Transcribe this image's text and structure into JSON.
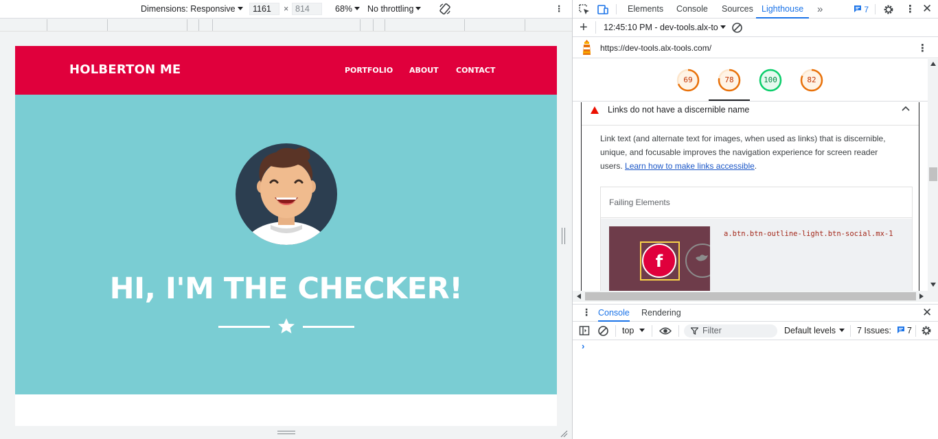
{
  "device_toolbar": {
    "dimensions_label": "Dimensions: Responsive",
    "width": "1161",
    "height": "814",
    "zoom": "68%",
    "throttling": "No throttling",
    "rotate_icon": "rotate-icon"
  },
  "site": {
    "brand": "HOLBERTON ME",
    "nav": [
      "PORTFOLIO",
      "ABOUT",
      "CONTACT"
    ],
    "hero_title": "HI, I'M THE CHECKER!",
    "colors": {
      "nav_bg": "#e0003c",
      "hero_bg": "#7acdd3"
    }
  },
  "devtools": {
    "tabs": [
      "Elements",
      "Console",
      "Sources",
      "Lighthouse"
    ],
    "active_tab": "Lighthouse",
    "issues_count": "7",
    "report_time": "12:45:10 PM - dev-tools.alx-to",
    "url": "https://dev-tools.alx-tools.com/",
    "scores": [
      {
        "value": "69",
        "color": "#e8710a"
      },
      {
        "value": "78",
        "color": "#e8710a"
      },
      {
        "value": "100",
        "color": "#0cce6b"
      },
      {
        "value": "82",
        "color": "#e8710a"
      }
    ],
    "audit": {
      "title": "Links do not have a discernible name",
      "description": "Link text (and alternate text for images, when used as links) that is discernible, unique, and focusable improves the navigation experience for screen reader users.",
      "link_text": "Learn how to make links accessible",
      "failing_heading": "Failing Elements",
      "selector": "a.btn.btn-outline-light.btn-social.mx-1"
    },
    "drawer": {
      "tabs": [
        "Console",
        "Rendering"
      ],
      "context": "top",
      "filter_placeholder": "Filter",
      "levels": "Default levels",
      "issues_label": "7 Issues:",
      "issues_count": "7"
    }
  }
}
